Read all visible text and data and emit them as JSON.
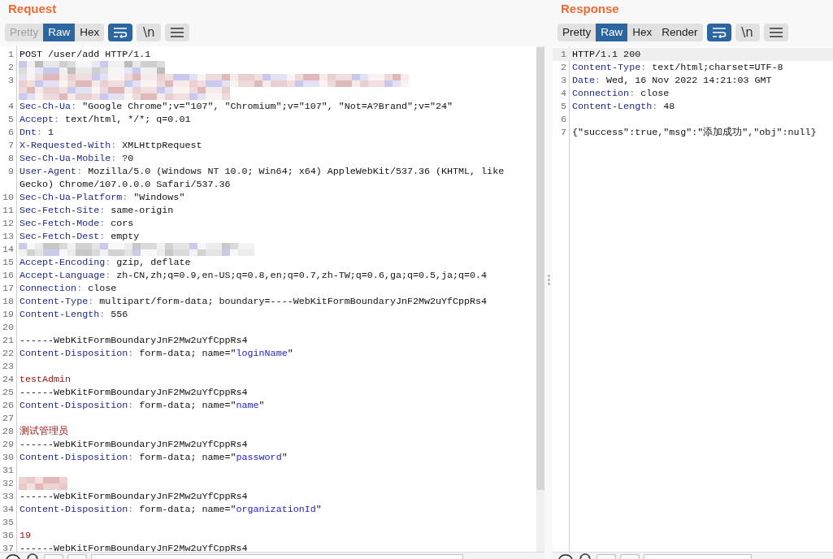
{
  "request": {
    "title": "Request",
    "tabs": [
      {
        "label": "Pretty",
        "selected": false,
        "disabled": true
      },
      {
        "label": "Raw",
        "selected": true,
        "disabled": false
      },
      {
        "label": "Hex",
        "selected": false,
        "disabled": false
      }
    ],
    "tools": [
      {
        "kind": "wrap",
        "on": true
      },
      {
        "kind": "newline",
        "label": "\\n",
        "on": false
      },
      {
        "kind": "menu",
        "on": false
      }
    ],
    "lines": [
      {
        "num": "1",
        "kind": "code",
        "current": false,
        "segments": [
          {
            "kind": "plain",
            "text": "POST /user/add HTTP/1.1"
          }
        ]
      },
      {
        "num": "2",
        "kind": "redacted",
        "current": false
      },
      {
        "num": "3",
        "kind": "redacted",
        "current": false
      },
      {
        "num": "4",
        "kind": "code",
        "current": false,
        "segments": [
          {
            "kind": "key",
            "text": "Sec-Ch-Ua"
          },
          {
            "kind": "sep",
            "text": ":"
          },
          {
            "kind": "plain",
            "text": " \"Google Chrome\";v=\"107\", \"Chromium\";v=\"107\", \"Not=A?Brand\";v=\"24\""
          }
        ]
      },
      {
        "num": "5",
        "kind": "code",
        "current": false,
        "segments": [
          {
            "kind": "key",
            "text": "Accept"
          },
          {
            "kind": "sep",
            "text": ":"
          },
          {
            "kind": "plain",
            "text": " text/html, */*; q=0.01"
          }
        ]
      },
      {
        "num": "6",
        "kind": "code",
        "current": false,
        "segments": [
          {
            "kind": "key",
            "text": "Dnt"
          },
          {
            "kind": "sep",
            "text": ":"
          },
          {
            "kind": "plain",
            "text": " 1"
          }
        ]
      },
      {
        "num": "7",
        "kind": "code",
        "current": false,
        "segments": [
          {
            "kind": "key",
            "text": "X-Requested-With"
          },
          {
            "kind": "sep",
            "text": ":"
          },
          {
            "kind": "plain",
            "text": " XMLHttpRequest"
          }
        ]
      },
      {
        "num": "8",
        "kind": "code",
        "current": false,
        "segments": [
          {
            "kind": "key",
            "text": "Sec-Ch-Ua-Mobile"
          },
          {
            "kind": "sep",
            "text": ":"
          },
          {
            "kind": "plain",
            "text": " ?0"
          }
        ]
      },
      {
        "num": "9",
        "kind": "code",
        "current": false,
        "segments": [
          {
            "kind": "key",
            "text": "User-Agent"
          },
          {
            "kind": "sep",
            "text": ":"
          },
          {
            "kind": "plain",
            "text": " Mozilla/5.0 (Windows NT 10.0; Win64; x64) AppleWebKit/537.36 (KHTML, like Gecko) Chrome/107.0.0.0 Safari/537.36"
          }
        ]
      },
      {
        "num": "10",
        "kind": "code",
        "current": false,
        "segments": [
          {
            "kind": "key",
            "text": "Sec-Ch-Ua-Platform"
          },
          {
            "kind": "sep",
            "text": ":"
          },
          {
            "kind": "plain",
            "text": " \"Windows\""
          }
        ]
      },
      {
        "num": "11",
        "kind": "code",
        "current": false,
        "segments": [
          {
            "kind": "key",
            "text": "Sec-Fetch-Site"
          },
          {
            "kind": "sep",
            "text": ":"
          },
          {
            "kind": "plain",
            "text": " same-origin"
          }
        ]
      },
      {
        "num": "12",
        "kind": "code",
        "current": false,
        "segments": [
          {
            "kind": "key",
            "text": "Sec-Fetch-Mode"
          },
          {
            "kind": "sep",
            "text": ":"
          },
          {
            "kind": "plain",
            "text": " cors"
          }
        ]
      },
      {
        "num": "13",
        "kind": "code",
        "current": false,
        "segments": [
          {
            "kind": "key",
            "text": "Sec-Fetch-Dest"
          },
          {
            "kind": "sep",
            "text": ":"
          },
          {
            "kind": "plain",
            "text": " empty"
          }
        ]
      },
      {
        "num": "14",
        "kind": "redacted",
        "current": false
      },
      {
        "num": "15",
        "kind": "code",
        "current": false,
        "segments": [
          {
            "kind": "key",
            "text": "Accept-Encoding"
          },
          {
            "kind": "sep",
            "text": ":"
          },
          {
            "kind": "plain",
            "text": " gzip, deflate"
          }
        ]
      },
      {
        "num": "16",
        "kind": "code",
        "current": false,
        "segments": [
          {
            "kind": "key",
            "text": "Accept-Language"
          },
          {
            "kind": "sep",
            "text": ":"
          },
          {
            "kind": "plain",
            "text": " zh-CN,zh;q=0.9,en-US;q=0.8,en;q=0.7,zh-TW;q=0.6,ga;q=0.5,ja;q=0.4"
          }
        ]
      },
      {
        "num": "17",
        "kind": "code",
        "current": false,
        "segments": [
          {
            "kind": "key",
            "text": "Connection"
          },
          {
            "kind": "sep",
            "text": ":"
          },
          {
            "kind": "plain",
            "text": " close"
          }
        ]
      },
      {
        "num": "18",
        "kind": "code",
        "current": false,
        "segments": [
          {
            "kind": "key",
            "text": "Content-Type"
          },
          {
            "kind": "sep",
            "text": ":"
          },
          {
            "kind": "plain",
            "text": " multipart/form-data; boundary=----WebKitFormBoundaryJnF2Mw2uYfCppRs4"
          }
        ]
      },
      {
        "num": "19",
        "kind": "code",
        "current": false,
        "segments": [
          {
            "kind": "key",
            "text": "Content-Length"
          },
          {
            "kind": "sep",
            "text": ":"
          },
          {
            "kind": "plain",
            "text": " 556"
          }
        ]
      },
      {
        "num": "20",
        "kind": "code",
        "current": false
      },
      {
        "num": "21",
        "kind": "code",
        "current": false,
        "segments": [
          {
            "kind": "plain",
            "text": "------WebKitFormBoundaryJnF2Mw2uYfCppRs4"
          }
        ]
      },
      {
        "num": "22",
        "kind": "code",
        "current": false,
        "segments": [
          {
            "kind": "key",
            "text": "Content-Disposition"
          },
          {
            "kind": "sep",
            "text": ":"
          },
          {
            "kind": "plain",
            "text": " form-data; name=\""
          },
          {
            "kind": "param",
            "text": "loginName"
          },
          {
            "kind": "plain",
            "text": "\""
          }
        ]
      },
      {
        "num": "23",
        "kind": "code",
        "current": false
      },
      {
        "num": "24",
        "kind": "code",
        "current": false,
        "segments": [
          {
            "kind": "body",
            "text": "testAdmin"
          }
        ]
      },
      {
        "num": "25",
        "kind": "code",
        "current": false,
        "segments": [
          {
            "kind": "plain",
            "text": "------WebKitFormBoundaryJnF2Mw2uYfCppRs4"
          }
        ]
      },
      {
        "num": "26",
        "kind": "code",
        "current": false,
        "segments": [
          {
            "kind": "key",
            "text": "Content-Disposition"
          },
          {
            "kind": "sep",
            "text": ":"
          },
          {
            "kind": "plain",
            "text": " form-data; name=\""
          },
          {
            "kind": "param",
            "text": "name"
          },
          {
            "kind": "plain",
            "text": "\""
          }
        ]
      },
      {
        "num": "27",
        "kind": "code",
        "current": false
      },
      {
        "num": "28",
        "kind": "code",
        "current": false,
        "segments": [
          {
            "kind": "body",
            "text": "测试管理员"
          }
        ]
      },
      {
        "num": "29",
        "kind": "code",
        "current": false,
        "segments": [
          {
            "kind": "plain",
            "text": "------WebKitFormBoundaryJnF2Mw2uYfCppRs4"
          }
        ]
      },
      {
        "num": "30",
        "kind": "code",
        "current": false,
        "segments": [
          {
            "kind": "key",
            "text": "Content-Disposition"
          },
          {
            "kind": "sep",
            "text": ":"
          },
          {
            "kind": "plain",
            "text": " form-data; name=\""
          },
          {
            "kind": "param",
            "text": "password"
          },
          {
            "kind": "plain",
            "text": "\""
          }
        ]
      },
      {
        "num": "31",
        "kind": "code",
        "current": false
      },
      {
        "num": "32",
        "kind": "redacted",
        "current": false
      },
      {
        "num": "33",
        "kind": "code",
        "current": false,
        "segments": [
          {
            "kind": "plain",
            "text": "------WebKitFormBoundaryJnF2Mw2uYfCppRs4"
          }
        ]
      },
      {
        "num": "34",
        "kind": "code",
        "current": false,
        "segments": [
          {
            "kind": "key",
            "text": "Content-Disposition"
          },
          {
            "kind": "sep",
            "text": ":"
          },
          {
            "kind": "plain",
            "text": " form-data; name=\""
          },
          {
            "kind": "param",
            "text": "organizationId"
          },
          {
            "kind": "plain",
            "text": "\""
          }
        ]
      },
      {
        "num": "35",
        "kind": "code",
        "current": false
      },
      {
        "num": "36",
        "kind": "code",
        "current": false,
        "segments": [
          {
            "kind": "body",
            "text": "19"
          }
        ]
      },
      {
        "num": "37",
        "kind": "code",
        "current": false,
        "segments": [
          {
            "kind": "plain",
            "text": "------WebKitFormBoundaryJnF2Mw2uYfCppRs4"
          }
        ]
      }
    ]
  },
  "response": {
    "title": "Response",
    "tabs": [
      {
        "label": "Pretty",
        "selected": false,
        "disabled": false
      },
      {
        "label": "Raw",
        "selected": true,
        "disabled": false
      },
      {
        "label": "Hex",
        "selected": false,
        "disabled": false
      },
      {
        "label": "Render",
        "selected": false,
        "disabled": false
      }
    ],
    "tools": [
      {
        "kind": "wrap",
        "on": true
      },
      {
        "kind": "newline",
        "label": "\\n",
        "on": false
      },
      {
        "kind": "menu",
        "on": false
      }
    ],
    "lines": [
      {
        "num": "1",
        "kind": "code",
        "current": true,
        "segments": [
          {
            "kind": "plain",
            "text": "HTTP/1.1 200"
          }
        ]
      },
      {
        "num": "2",
        "kind": "code",
        "current": false,
        "segments": [
          {
            "kind": "key",
            "text": "Content-Type"
          },
          {
            "kind": "sep",
            "text": ":"
          },
          {
            "kind": "plain",
            "text": " text/html;charset=UTF-8"
          }
        ]
      },
      {
        "num": "3",
        "kind": "code",
        "current": false,
        "segments": [
          {
            "kind": "key",
            "text": "Date"
          },
          {
            "kind": "sep",
            "text": ":"
          },
          {
            "kind": "plain",
            "text": " Wed, 16 Nov 2022 14:21:03 GMT"
          }
        ]
      },
      {
        "num": "4",
        "kind": "code",
        "current": false,
        "segments": [
          {
            "kind": "key",
            "text": "Connection"
          },
          {
            "kind": "sep",
            "text": ":"
          },
          {
            "kind": "plain",
            "text": " close"
          }
        ]
      },
      {
        "num": "5",
        "kind": "code",
        "current": false,
        "segments": [
          {
            "kind": "key",
            "text": "Content-Length"
          },
          {
            "kind": "sep",
            "text": ":"
          },
          {
            "kind": "plain",
            "text": " 48"
          }
        ]
      },
      {
        "num": "6",
        "kind": "code",
        "current": false
      },
      {
        "num": "7",
        "kind": "code",
        "current": false,
        "segments": [
          {
            "kind": "plain",
            "text": "{\"success\":true,\"msg\":\"添加成功\",\"obj\":null}"
          }
        ]
      }
    ]
  }
}
